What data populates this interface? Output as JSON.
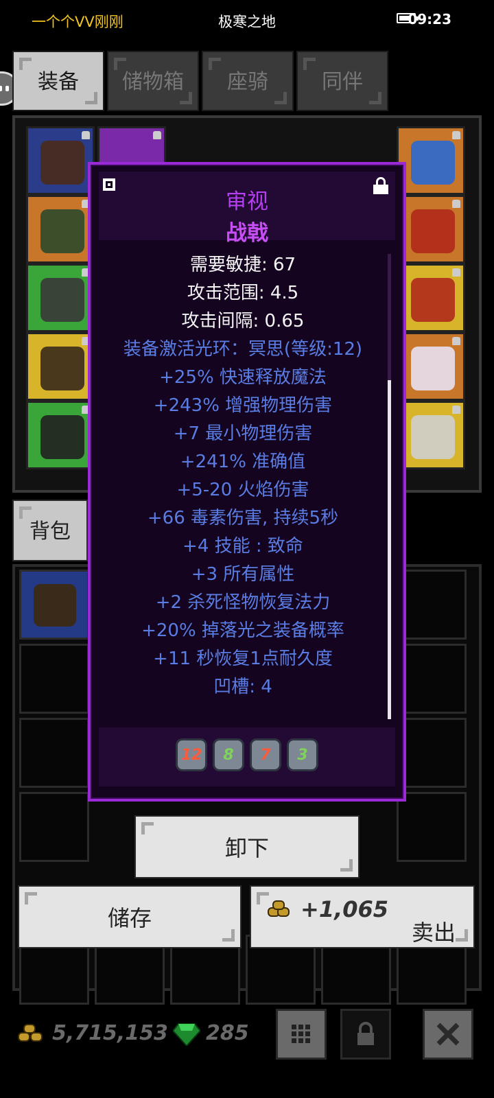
{
  "status_bar": {
    "user": "一个个VV刚刚",
    "map": "极寒之地",
    "time": "09:23"
  },
  "tabs": [
    {
      "label": "装备",
      "active": true
    },
    {
      "label": "储物箱",
      "active": false
    },
    {
      "label": "座骑",
      "active": false
    },
    {
      "label": "同伴",
      "active": false
    }
  ],
  "bag_tab": "背包",
  "tooltip": {
    "header": "审视",
    "item_name": "战戟",
    "lines": [
      {
        "text": "需要敏捷: 67",
        "color": "white"
      },
      {
        "text": "攻击范围: 4.5",
        "color": "white"
      },
      {
        "text": "攻击间隔: 0.65",
        "color": "white"
      },
      {
        "text": "装备激活光环：冥思(等级:12)",
        "color": "blue"
      },
      {
        "text": "+25% 快速释放魔法",
        "color": "blue"
      },
      {
        "text": "+243% 增强物理伤害",
        "color": "blue"
      },
      {
        "text": "+7 最小物理伤害",
        "color": "blue"
      },
      {
        "text": "+241% 准确值",
        "color": "blue"
      },
      {
        "text": "+5-20 火焰伤害",
        "color": "blue"
      },
      {
        "text": "+66 毒素伤害, 持续5秒",
        "color": "blue"
      },
      {
        "text": "+4 技能 : 致命",
        "color": "blue"
      },
      {
        "text": "+3 所有属性",
        "color": "blue"
      },
      {
        "text": "+2 杀死怪物恢复法力",
        "color": "blue"
      },
      {
        "text": "+20% 掉落光之装备概率",
        "color": "blue"
      },
      {
        "text": "+11 秒恢复1点耐久度",
        "color": "blue"
      },
      {
        "text": "凹槽: 4",
        "color": "blue"
      }
    ],
    "sockets": [
      {
        "value": "12",
        "color": "#ff5a3a"
      },
      {
        "value": "8",
        "color": "#7fd35a"
      },
      {
        "value": "7",
        "color": "#ff5a3a"
      },
      {
        "value": "3",
        "color": "#7fd35a"
      }
    ]
  },
  "actions": {
    "unequip": "卸下",
    "store": "储存",
    "sell": "卖出",
    "sell_price": "+1,065"
  },
  "footer": {
    "gold": "5,715,153",
    "gems": "285"
  },
  "colors": {
    "tooltip_border": "#9a2ad6",
    "magic_text": "#5a7de4",
    "title_purple": "#c74ef5",
    "status_user": "#f3c51e"
  }
}
